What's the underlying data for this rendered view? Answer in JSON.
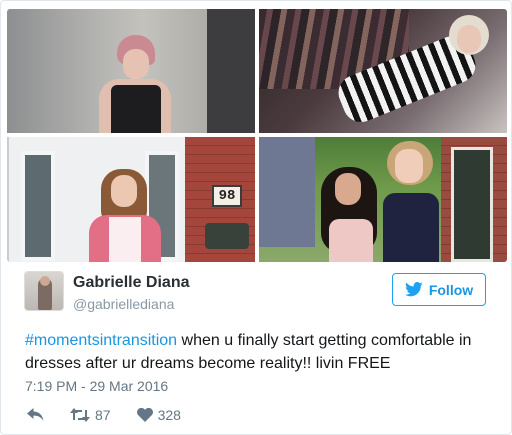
{
  "tweet": {
    "author_name": "Gabrielle Diana",
    "author_handle": "@gabriellediana",
    "follow_label": "Follow",
    "hashtag": "#momentsintransition",
    "text_rest": " when u finally start getting comfortable in dresses after ur dreams become reality!! livin FREE",
    "timestamp": "7:19 PM - 29 Mar 2016",
    "retweet_count": "87",
    "like_count": "328",
    "photos": {
      "house_number": "98"
    }
  },
  "icons": {
    "follow": "twitter-bird-icon",
    "reply": "reply-icon",
    "retweet": "retweet-icon",
    "like": "heart-icon"
  },
  "colors": {
    "accent": "#1da1f2",
    "link": "#1b95e0",
    "text": "#14171a",
    "muted": "#657786",
    "border": "#e1e8ed"
  }
}
